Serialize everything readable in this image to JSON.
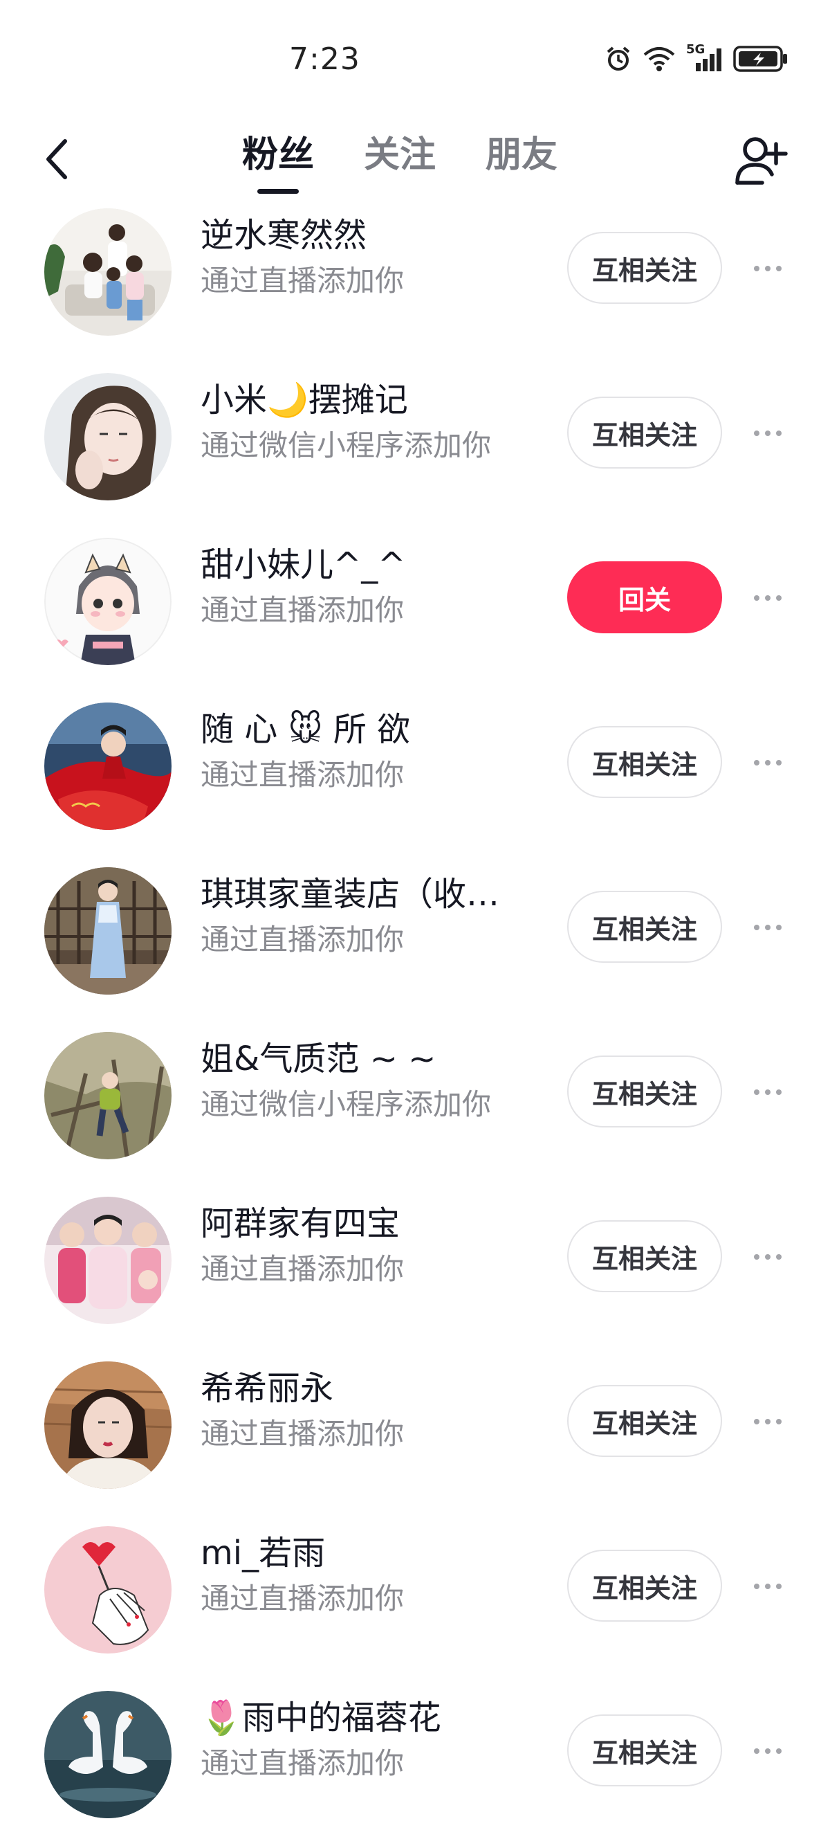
{
  "status_bar": {
    "time": "7:23",
    "network": "5G"
  },
  "nav": {
    "tabs": [
      {
        "label": "粉丝",
        "active": true
      },
      {
        "label": "关注",
        "active": false
      },
      {
        "label": "朋友",
        "active": false
      }
    ],
    "back_icon": "chevron-left-icon",
    "add_user_icon": "add-user-icon"
  },
  "colors": {
    "accent": "#fe2c55",
    "text_primary": "#161823",
    "text_secondary": "#8a8b91"
  },
  "followers": [
    {
      "name": "逆水寒然然",
      "source": "通过直播添加你",
      "button": "互相关注",
      "primary": false,
      "avatar": "family-photo"
    },
    {
      "name": "小米🌙摆摊记",
      "source": "通过微信小程序添加你",
      "button": "互相关注",
      "primary": false,
      "avatar": "woman-portrait"
    },
    {
      "name": "甜小妹儿^_^",
      "source": "通过直播添加你",
      "button": "回关",
      "primary": true,
      "avatar": "cartoon-girl"
    },
    {
      "name": "随 心 🐭 所 欲",
      "source": "通过直播添加你",
      "button": "互相关注",
      "primary": false,
      "avatar": "red-dress-woman"
    },
    {
      "name": "琪琪家童装店（收…",
      "source": "通过直播添加你",
      "button": "互相关注",
      "primary": false,
      "avatar": "girl-blue-dress"
    },
    {
      "name": "姐&气质范 ~ ~",
      "source": "通过微信小程序添加你",
      "button": "互相关注",
      "primary": false,
      "avatar": "child-on-tree"
    },
    {
      "name": "阿群家有四宝",
      "source": "通过直播添加你",
      "button": "互相关注",
      "primary": false,
      "avatar": "kids-group"
    },
    {
      "name": "希希丽永",
      "source": "通过直播添加你",
      "button": "互相关注",
      "primary": false,
      "avatar": "woman-fur-coat"
    },
    {
      "name": "mi_若雨",
      "source": "通过直播添加你",
      "button": "互相关注",
      "primary": false,
      "avatar": "heart-hand-illustration"
    },
    {
      "name": "🌷雨中的福蓉花",
      "source": "通过直播添加你",
      "button": "互相关注",
      "primary": false,
      "avatar": "swans-heart"
    }
  ]
}
